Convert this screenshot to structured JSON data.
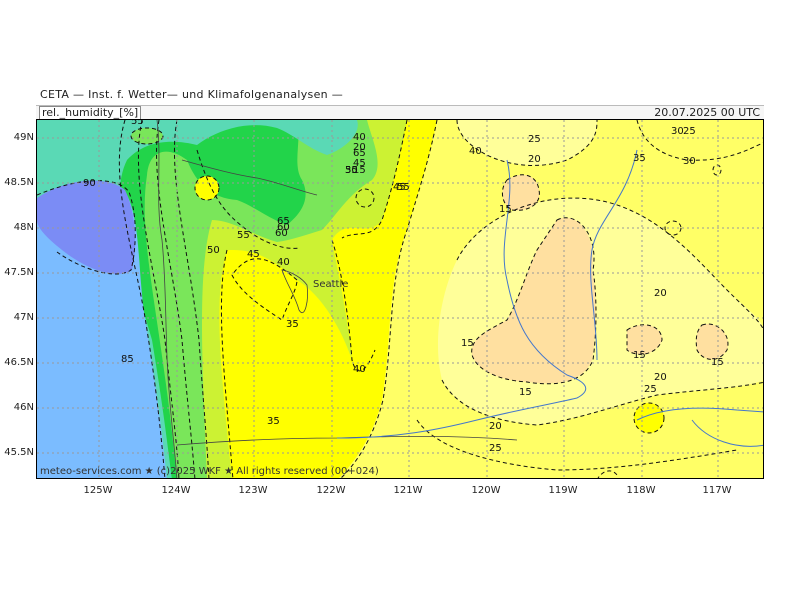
{
  "header": {
    "source": "CETA — Inst. f. Wetter— und Klimafolgenanalysen —",
    "variable": "rel._humidity_[%]",
    "valid_time": "20.07.2025 00 UTC"
  },
  "map": {
    "footer": "meteo-services.com ★ (c)2025 WKF ★ All rights reserved (00+024)",
    "city": "Seattle",
    "colors": {
      "rh_10": "#ffe0a0",
      "rh_20": "#ffff99",
      "rh_30": "#ffff66",
      "rh_40": "#ffff00",
      "rh_50": "#ccf233",
      "rh_60": "#7ae65a",
      "rh_70": "#22d44a",
      "rh_80": "#5ad9b5",
      "rh_90": "#7bbcff",
      "rh_95": "#7b8cf5",
      "gridline": "#999999",
      "coastline": "#444444",
      "rivers": "#4477cc"
    }
  },
  "axes": {
    "lat_labels": [
      "49N",
      "48.5N",
      "48N",
      "47.5N",
      "47N",
      "46.5N",
      "46N",
      "45.5N"
    ],
    "lon_labels": [
      "125W",
      "124W",
      "123W",
      "122W",
      "121W",
      "120W",
      "119W",
      "118W",
      "117W"
    ]
  },
  "contour_labels": [
    "90",
    "85",
    "65",
    "55",
    "50",
    "45",
    "40",
    "35",
    "30",
    "25",
    "20",
    "15",
    "60",
    "45",
    "40",
    "35",
    "15",
    "20",
    "25",
    "20",
    "15",
    "15",
    "25",
    "20",
    "15",
    "40",
    "35",
    "30",
    "45",
    "25",
    "20",
    "15",
    "35",
    "40",
    "50",
    "55",
    "60",
    "65",
    "55"
  ]
}
